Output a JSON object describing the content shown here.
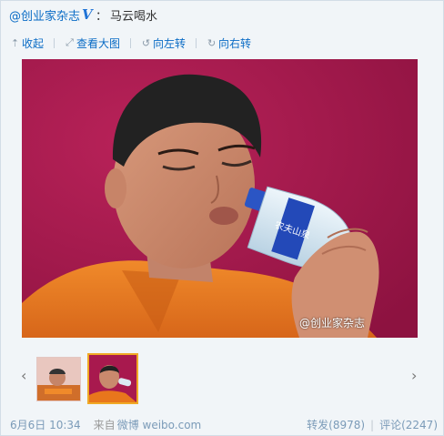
{
  "post": {
    "author": "@创业家杂志",
    "verified_badge": "V",
    "colon": "：",
    "text": "马云喝水"
  },
  "toolbar": {
    "collapse": {
      "label": "收起",
      "icon": "collapse-arrow-icon"
    },
    "view_large": {
      "label": "查看大图",
      "icon": "enlarge-icon"
    },
    "rotate_left": {
      "label": "向左转",
      "icon": "rotate-left-icon"
    },
    "rotate_right": {
      "label": "向右转",
      "icon": "rotate-right-icon"
    }
  },
  "image": {
    "watermark": "@创业家杂志",
    "bottle_label": "农夫山泉"
  },
  "carousel": {
    "prev": "‹",
    "next": "›",
    "selected_index": 1
  },
  "footer": {
    "timestamp": "6月6日 10:34",
    "source_prefix": "来自",
    "source": "微博 weibo.com",
    "repost": "转发(8978)",
    "divider": "|",
    "comment": "评论(2247)"
  },
  "colors": {
    "link": "#0a6cc5",
    "meta": "#7b9bb8",
    "background": "#f1f5f8",
    "photo_bg": "#a8194e",
    "shirt": "#e8761c",
    "thumb_selected": "#f0a925"
  }
}
